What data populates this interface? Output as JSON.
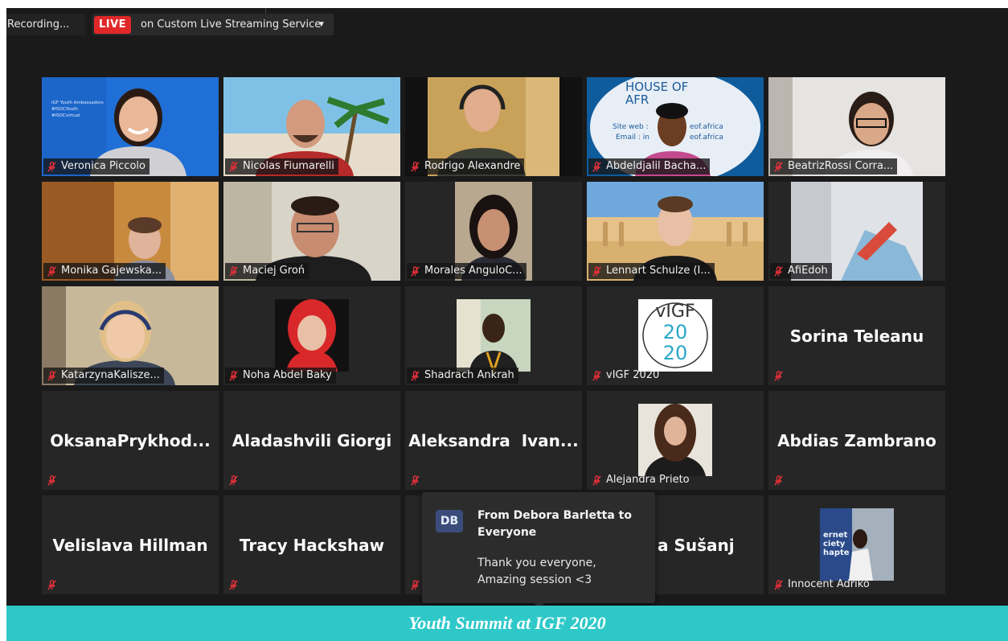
{
  "topbar": {
    "recording_text": "Recording...",
    "live_badge": "LIVE",
    "live_service": "on Custom Live Streaming Service"
  },
  "participants": [
    {
      "name": "Veronica Piccolo",
      "display": "video"
    },
    {
      "name": "Nicolas Fiumarelli",
      "display": "video"
    },
    {
      "name": "Rodrigo Alexandre",
      "display": "video"
    },
    {
      "name": "Abdeldjalil Bacha...",
      "display": "video"
    },
    {
      "name": "BeatrizRossi Corra...",
      "display": "video"
    },
    {
      "name": "Monika Gajewska...",
      "display": "video"
    },
    {
      "name": "Maciej Groń",
      "display": "video"
    },
    {
      "name": "Morales AnguloC...",
      "display": "video"
    },
    {
      "name": "Lennart Schulze (I...",
      "display": "video"
    },
    {
      "name": "AfiEdoh",
      "display": "video"
    },
    {
      "name": "KatarzynaKalisze...",
      "display": "video"
    },
    {
      "name": "Noha Abdel Baky",
      "display": "photo"
    },
    {
      "name": "Shadrach Ankrah",
      "display": "photo"
    },
    {
      "name": "vIGF 2020",
      "display": "logo"
    },
    {
      "name": "Sorina Teleanu",
      "display": "name_only"
    },
    {
      "name": "OksanaPrykhod...",
      "display": "name_only"
    },
    {
      "name": "Aladashvili Giorgi",
      "display": "name_only"
    },
    {
      "name": "Aleksandra  Ivan...",
      "display": "name_only"
    },
    {
      "name": "Alejandra Prieto",
      "display": "photo"
    },
    {
      "name": "Abdias Zambrano",
      "display": "name_only"
    },
    {
      "name": "Velislava Hillman",
      "display": "name_only"
    },
    {
      "name": "Tracy Hackshaw",
      "display": "name_only"
    },
    {
      "name": "",
      "display": "name_only"
    },
    {
      "name": "a Sušanj",
      "display": "name_only"
    },
    {
      "name": "Innocent Adriko",
      "display": "photo"
    }
  ],
  "background_text": {
    "veronica_slide": [
      "IGF Youth Ambassadors",
      "#ISOCYouth",
      "#ISOCvirtual"
    ],
    "house_of_africa": [
      "HOUSE OF",
      "AFR",
      "Site web :",
      "eof.africa",
      "Email : in",
      "eof.africa"
    ],
    "vigf_logo": [
      "vIGF",
      "20",
      "20"
    ],
    "innocent_banner": [
      "ernet",
      "ciety",
      "hapte"
    ]
  },
  "chat": {
    "avatar_initials": "DB",
    "title": "From Debora Barletta to Everyone",
    "message": "Thank you everyone, Amazing session <3"
  },
  "caption": "Youth Summit at IGF 2020",
  "colors": {
    "background": "#1a1a1a",
    "tile": "#262626",
    "live_red": "#e02828",
    "muted_red": "#e0303a",
    "caption_teal": "#2fc8c8",
    "avatar_blue": "#3a4d7a"
  },
  "icons": {
    "muted": "microphone-muted-icon",
    "dropdown": "caret-down-icon"
  }
}
